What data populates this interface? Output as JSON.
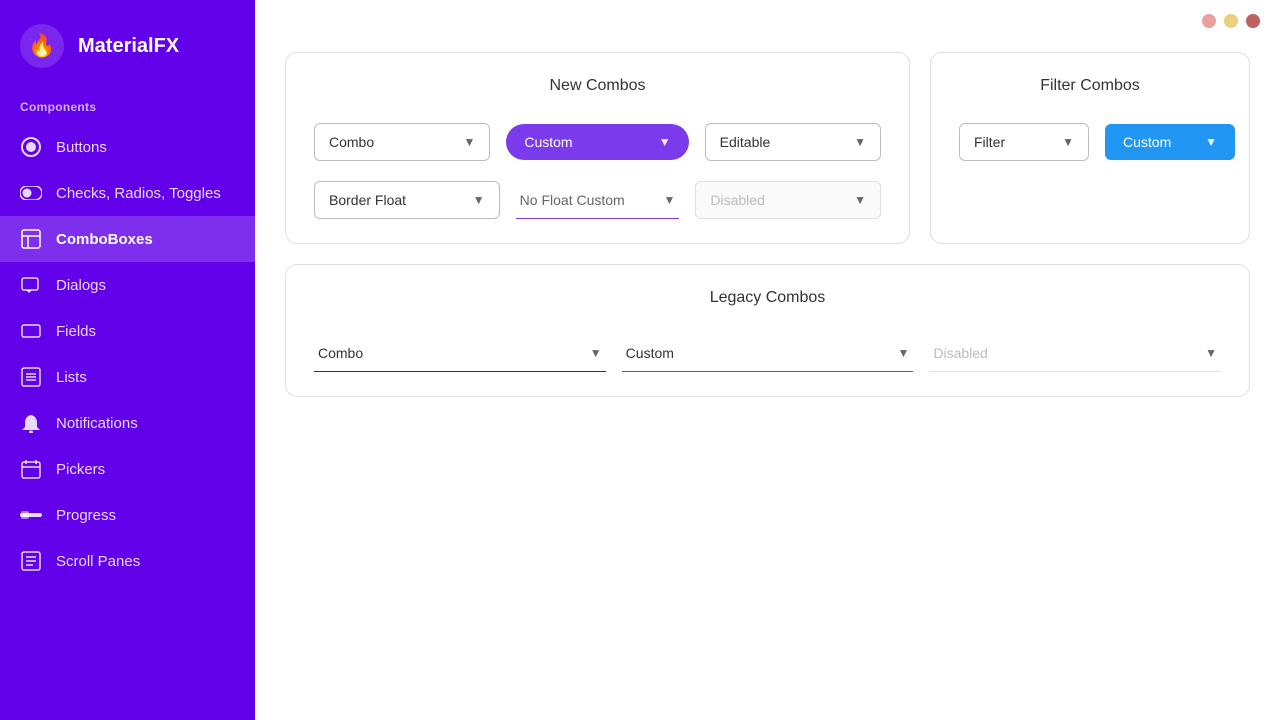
{
  "app": {
    "name": "MaterialFX",
    "logo_icon": "🔥"
  },
  "header": {
    "dots": [
      {
        "color": "#e8a0a0",
        "name": "dot-1"
      },
      {
        "color": "#e8d080",
        "name": "dot-2"
      },
      {
        "color": "#c06060",
        "name": "dot-3"
      }
    ]
  },
  "sidebar": {
    "section_label": "Components",
    "items": [
      {
        "label": "Buttons",
        "icon": "⬤",
        "icon_name": "radio-icon",
        "active": false
      },
      {
        "label": "Checks, Radios, Toggles",
        "icon": "◉",
        "icon_name": "toggle-icon",
        "active": false
      },
      {
        "label": "ComboBoxes",
        "icon": "▦",
        "icon_name": "combobox-icon",
        "active": true
      },
      {
        "label": "Dialogs",
        "icon": "💬",
        "icon_name": "dialog-icon",
        "active": false
      },
      {
        "label": "Fields",
        "icon": "▭",
        "icon_name": "fields-icon",
        "active": false
      },
      {
        "label": "Lists",
        "icon": "☰",
        "icon_name": "lists-icon",
        "active": false
      },
      {
        "label": "Notifications",
        "icon": "🔔",
        "icon_name": "notifications-icon",
        "active": false
      },
      {
        "label": "Pickers",
        "icon": "📅",
        "icon_name": "pickers-icon",
        "active": false
      },
      {
        "label": "Progress",
        "icon": "▬",
        "icon_name": "progress-icon",
        "active": false
      },
      {
        "label": "Scroll Panes",
        "icon": "▤",
        "icon_name": "scroll-panes-icon",
        "active": false
      }
    ]
  },
  "new_combos": {
    "title": "New Combos",
    "row1": [
      {
        "label": "Combo",
        "style": "standard"
      },
      {
        "label": "Custom",
        "style": "purple"
      },
      {
        "label": "Editable",
        "style": "standard"
      }
    ],
    "row2": [
      {
        "label": "Border Float",
        "style": "standard"
      },
      {
        "label": "No Float Custom",
        "style": "underline"
      },
      {
        "label": "Disabled",
        "style": "disabled"
      }
    ]
  },
  "filter_combos": {
    "title": "Filter Combos",
    "row1": [
      {
        "label": "Filter",
        "style": "standard"
      },
      {
        "label": "Custom",
        "style": "blue"
      }
    ]
  },
  "legacy_combos": {
    "title": "Legacy Combos",
    "row1": [
      {
        "label": "Combo",
        "style": "legacy"
      },
      {
        "label": "Custom",
        "style": "legacy-custom"
      },
      {
        "label": "Disabled",
        "style": "legacy-disabled"
      }
    ]
  }
}
